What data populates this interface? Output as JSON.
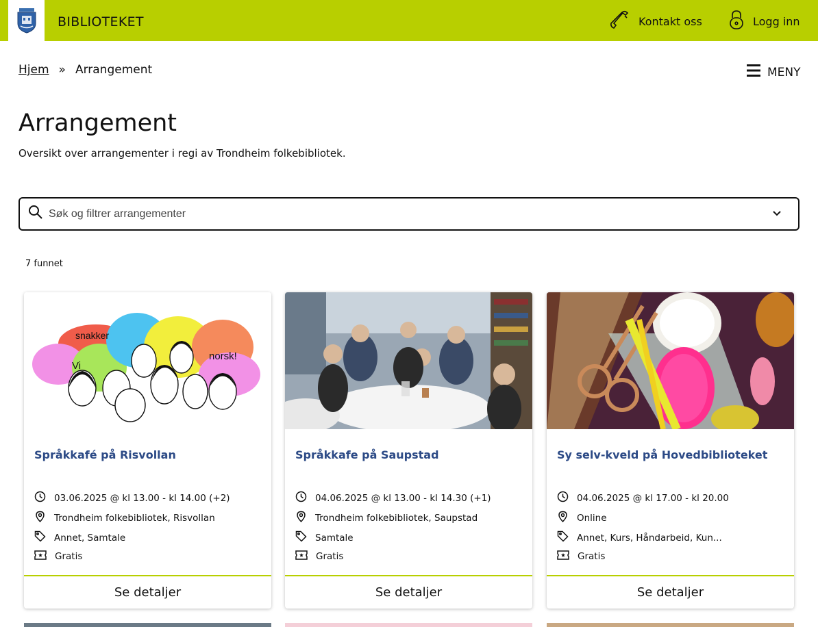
{
  "header": {
    "site_title": "BIBLIOTEKET",
    "contact_label": "Kontakt oss",
    "login_label": "Logg inn",
    "brand_color": "#b8cf00"
  },
  "breadcrumb": {
    "home": "Hjem",
    "separator": "»",
    "current": "Arrangement"
  },
  "menu": {
    "label": "MENY"
  },
  "page": {
    "title": "Arrangement",
    "description": "Oversikt over arrangementer i regi av Trondheim folkebibliotek."
  },
  "search": {
    "placeholder": "Søk og filtrer arrangementer"
  },
  "results": {
    "count_label": "7 funnet"
  },
  "cards": [
    {
      "title": "Språkkafé på Risvollan",
      "date": "03.06.2025 @ kl 13.00 - kl 14.00 (+2)",
      "location": "Trondheim folkebibliotek, Risvollan",
      "tags": "Annet, Samtale",
      "price": "Gratis",
      "button": "Se detaljer",
      "image_words": [
        "Vi",
        "snakker",
        "norsk!"
      ]
    },
    {
      "title": "Språkkafe på Saupstad",
      "date": "04.06.2025 @ kl 13.00 - kl 14.30 (+1)",
      "location": "Trondheim folkebibliotek, Saupstad",
      "tags": "Samtale",
      "price": "Gratis",
      "button": "Se detaljer"
    },
    {
      "title": "Sy selv-kveld på Hovedbiblioteket",
      "date": "04.06.2025 @ kl 17.00 - kl 20.00",
      "location": "Online",
      "tags": "Annet, Kurs, Håndarbeid, Kun...",
      "price": "Gratis",
      "button": "Se detaljer"
    }
  ],
  "colors": {
    "card_title": "#2c4a86",
    "footer_border": "#b8cf00"
  },
  "icons": [
    "coat-of-arms-logo",
    "phone-icon",
    "lock-icon",
    "hamburger-icon",
    "search-icon",
    "chevron-down-icon",
    "clock-icon",
    "location-pin-icon",
    "tag-icon",
    "ticket-icon"
  ]
}
